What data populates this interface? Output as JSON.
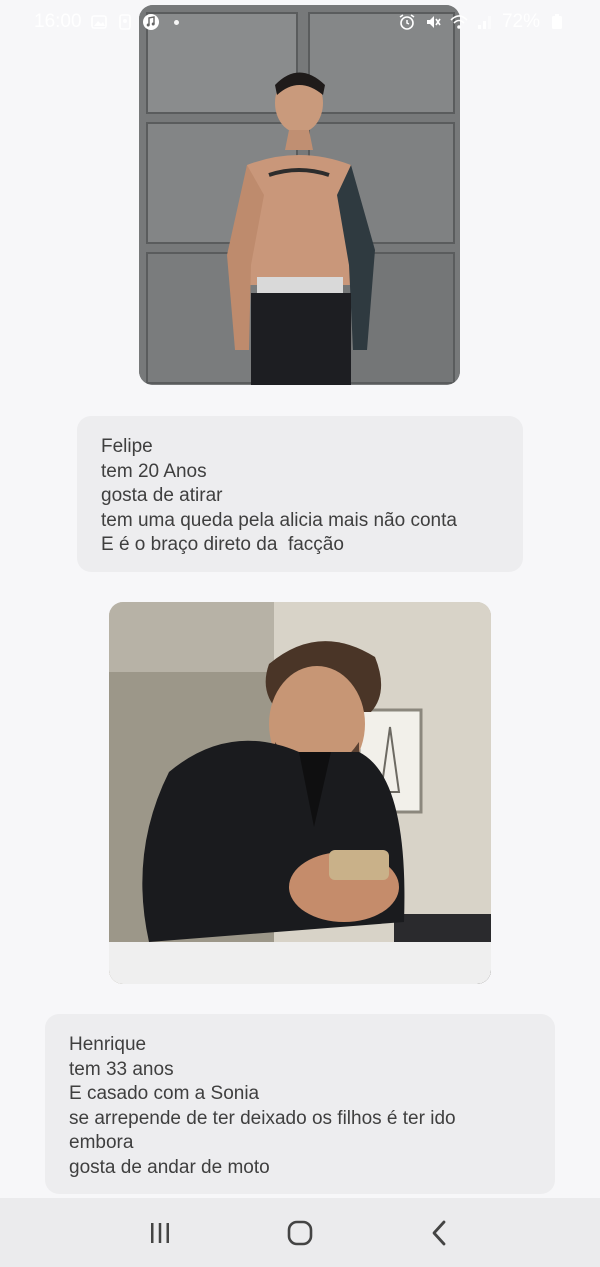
{
  "status_bar": {
    "time": "16:00",
    "battery": "72%",
    "icons": [
      "gallery-icon",
      "notification-icon",
      "music-icon",
      "alarm-icon",
      "mute-icon",
      "wifi-icon",
      "signal-icon",
      "battery-icon"
    ]
  },
  "messages": [
    {
      "type": "image",
      "subject": "Felipe"
    },
    {
      "type": "text",
      "lines": [
        "Felipe",
        "tem 20 Anos",
        "gosta de atirar",
        "tem uma queda pela alicia mais não conta",
        "E é o braço direto da  facção"
      ]
    },
    {
      "type": "image",
      "subject": "Henrique"
    },
    {
      "type": "text",
      "lines": [
        "Henrique",
        "tem 33 anos",
        "E casado com a Sonia",
        "se arrepende de ter deixado os filhos é ter ido",
        "embora",
        "gosta de andar de moto"
      ]
    }
  ],
  "navigation": {
    "buttons": [
      "recent-apps",
      "home",
      "back"
    ]
  },
  "colors": {
    "background": "#f7f7f9",
    "bubble": "#ededef",
    "text": "#3f3f3f",
    "nav_bar": "#ebebed"
  }
}
